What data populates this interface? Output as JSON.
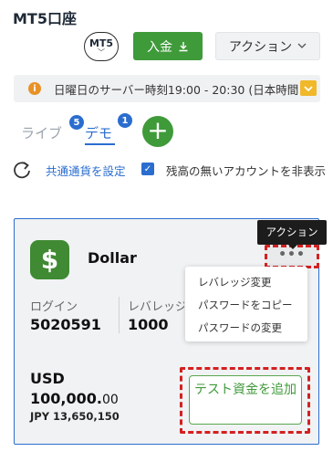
{
  "page": {
    "title": "MT5口座"
  },
  "header": {
    "platform_badge": "MT5",
    "deposit_label": "入金",
    "action_label": "アクション"
  },
  "notice": {
    "text": "日曜日のサーバー時刻19:00 - 20:30 (日本時間"
  },
  "tabs": [
    {
      "label": "ライブ",
      "badge": "5",
      "active": false
    },
    {
      "label": "デモ",
      "badge": "1",
      "active": true
    }
  ],
  "options": {
    "common_currency_label": "共通通貨を設定",
    "hide_zero_label": "残高の無いアカウントを非表示",
    "hide_zero_checked": true
  },
  "account": {
    "icon_symbol": "$",
    "name": "Dollar",
    "menu_tooltip": "アクション",
    "menu_dots": "•••",
    "menu_items": [
      "レバレッジ変更",
      "パスワードをコピー",
      "パスワードの変更"
    ],
    "login_label": "ログイン",
    "login_value": "5020591",
    "leverage_label": "レバレッジ",
    "leverage_value": "1000",
    "currency": "USD",
    "balance_main": "100,000.",
    "balance_cents": "00",
    "jpy_equivalent": "JPY 13,650,150",
    "add_funds_label": "テスト資金を追加"
  },
  "colors": {
    "accent_blue": "#2b6dcf",
    "green": "#3f9a3a",
    "highlight_red": "#d42020",
    "warning_orange": "#e8922a"
  }
}
